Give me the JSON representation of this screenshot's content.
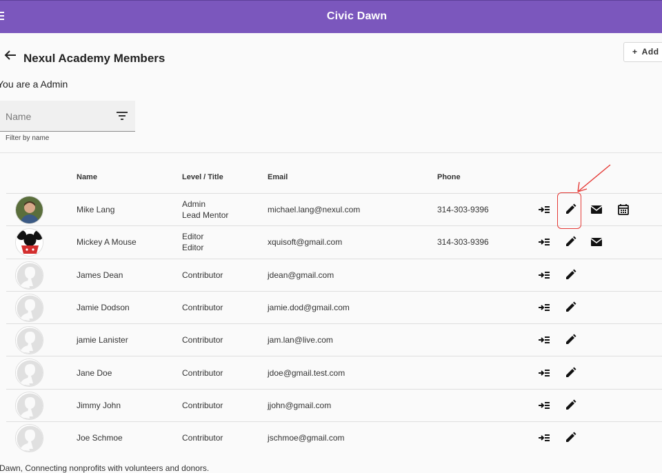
{
  "app": {
    "title": "Civic Dawn"
  },
  "header": {
    "page_title": "Nexul Academy Members",
    "add_label": "Add"
  },
  "role_text": "You are a Admin",
  "filter": {
    "placeholder": "Name",
    "hint": "Filter by name"
  },
  "table": {
    "columns": {
      "name": "Name",
      "level": "Level / Title",
      "email": "Email",
      "phone": "Phone"
    },
    "rows": [
      {
        "name": "Mike Lang",
        "level": "Admin",
        "title": "Lead Mentor",
        "email": "michael.lang@nexul.com",
        "phone": "314-303-9396",
        "avatar": "photo",
        "actions": [
          "move-icon",
          "edit-icon",
          "mail-icon",
          "calendar-icon"
        ]
      },
      {
        "name": "Mickey A Mouse",
        "level": "Editor",
        "title": "Editor",
        "email": "xquisoft@gmail.com",
        "phone": "314-303-9396",
        "avatar": "mickey",
        "actions": [
          "move-icon",
          "edit-icon",
          "mail-icon"
        ]
      },
      {
        "name": "James Dean",
        "level": "Contributor",
        "title": "",
        "email": "jdean@gmail.com",
        "phone": "",
        "avatar": "placeholder",
        "actions": [
          "move-icon",
          "edit-icon"
        ]
      },
      {
        "name": "Jamie Dodson",
        "level": "Contributor",
        "title": "",
        "email": "jamie.dod@gmail.com",
        "phone": "",
        "avatar": "placeholder",
        "actions": [
          "move-icon",
          "edit-icon"
        ]
      },
      {
        "name": "jamie Lanister",
        "level": "Contributor",
        "title": "",
        "email": "jam.lan@live.com",
        "phone": "",
        "avatar": "placeholder",
        "actions": [
          "move-icon",
          "edit-icon"
        ]
      },
      {
        "name": "Jane Doe",
        "level": "Contributor",
        "title": "",
        "email": "jdoe@gmail.test.com",
        "phone": "",
        "avatar": "placeholder",
        "actions": [
          "move-icon",
          "edit-icon"
        ]
      },
      {
        "name": "Jimmy John",
        "level": "Contributor",
        "title": "",
        "email": "jjohn@gmail.com",
        "phone": "",
        "avatar": "placeholder",
        "actions": [
          "move-icon",
          "edit-icon"
        ]
      },
      {
        "name": "Joe Schmoe",
        "level": "Contributor",
        "title": "",
        "email": "jschmoe@gmail.com",
        "phone": "",
        "avatar": "placeholder",
        "actions": [
          "move-icon",
          "edit-icon"
        ]
      }
    ]
  },
  "footer": {
    "text": "Dawn, Connecting nonprofits with volunteers and donors."
  },
  "colors": {
    "appbar": "#7b57bd",
    "annotation": "#e53935"
  }
}
